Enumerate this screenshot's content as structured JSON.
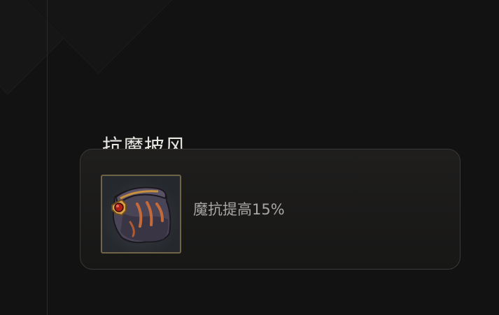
{
  "item": {
    "name": "抗魔披风",
    "description": "魔抗提高15%",
    "icon": "magic-resist-cloak-icon"
  },
  "colors": {
    "background": "#121212",
    "title_text": "#e8e6e1",
    "description_text": "#a8a6a2",
    "frame_border": "#6f6447",
    "card_border": "#3a3937"
  }
}
